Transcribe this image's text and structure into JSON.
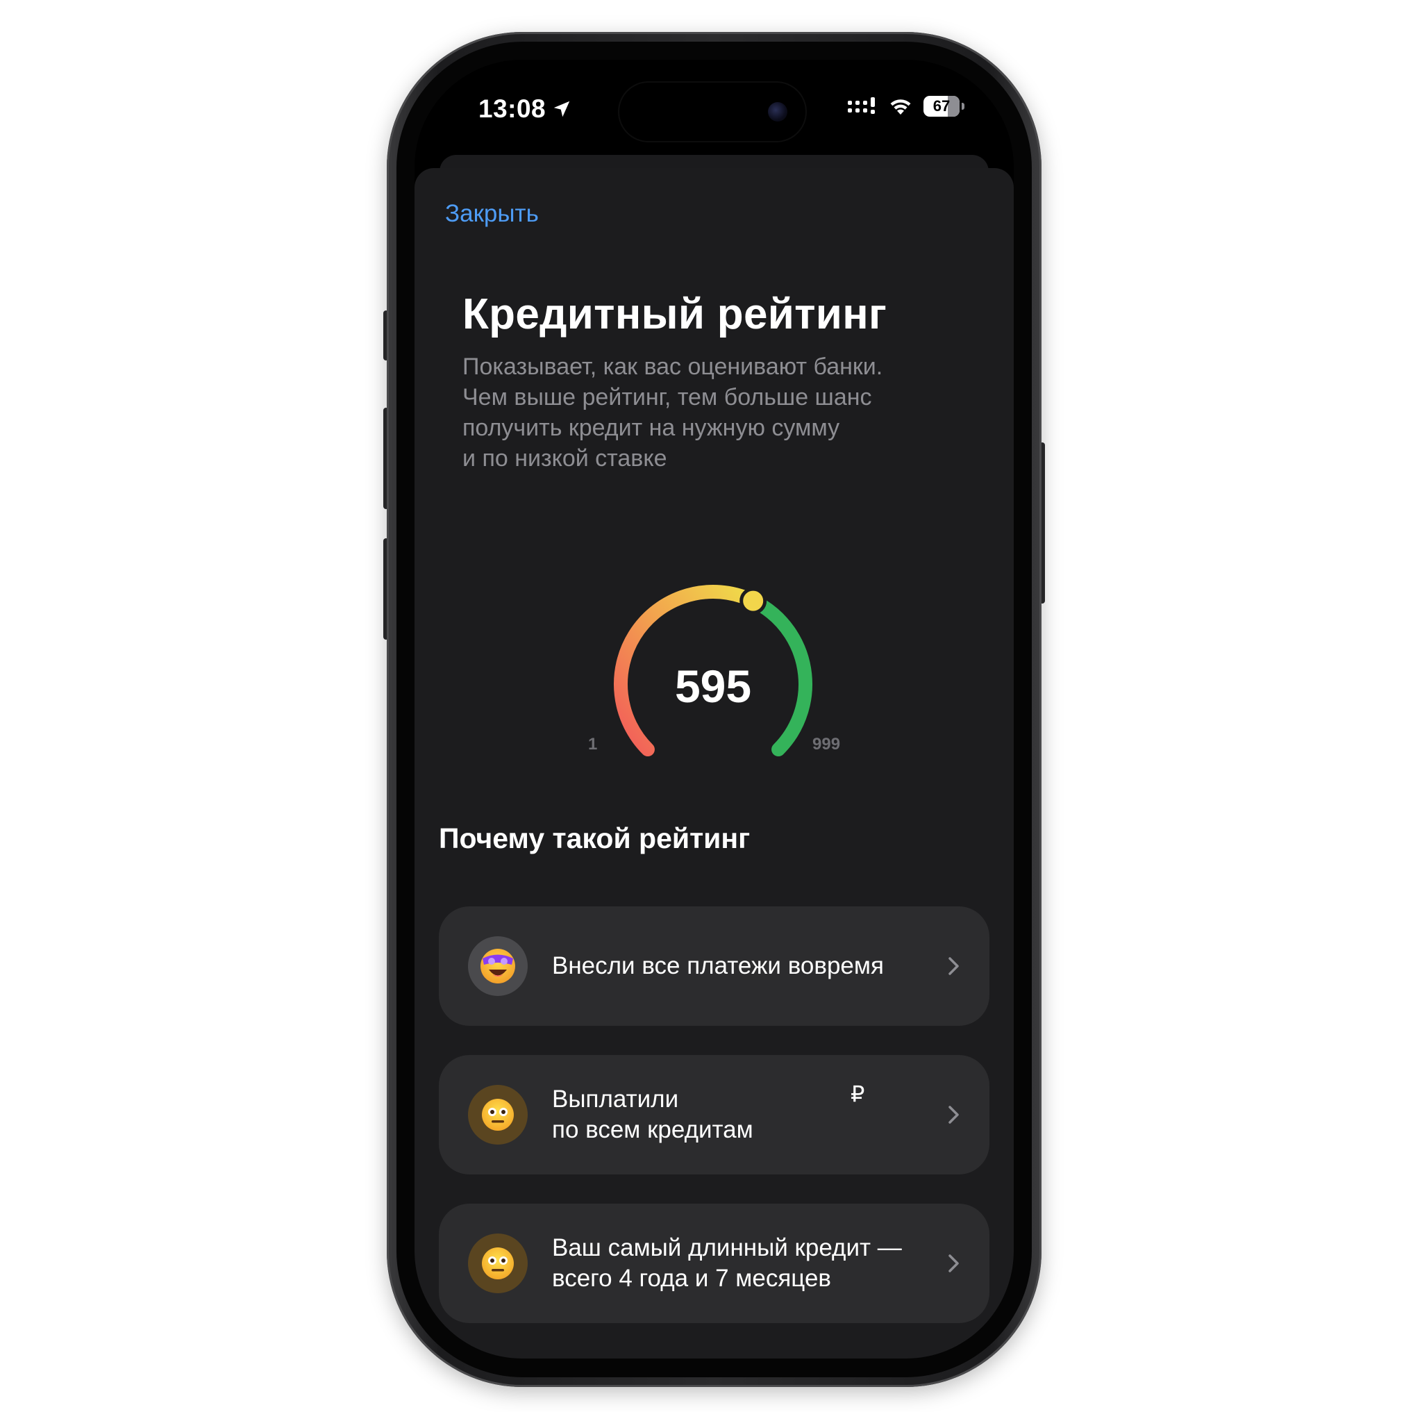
{
  "status_bar": {
    "time": "13:08",
    "battery": "67",
    "icons": [
      "location-arrow-icon",
      "cellular-signal-icon",
      "wifi-icon",
      "battery-icon"
    ]
  },
  "sheet": {
    "close_label": "Закрыть"
  },
  "header": {
    "title": "Кредитный рейтинг",
    "subtitle_lines": [
      "Показывает, как вас оценивают банки.",
      "Чем выше рейтинг, тем больше шанс",
      "получить кредит на нужную сумму",
      "и по низкой ставке"
    ]
  },
  "gauge": {
    "value": "595",
    "min_label": "1",
    "max_label": "999",
    "min": 1,
    "max": 999,
    "score": 595,
    "colors": {
      "low": "#f25a5a",
      "mid": "#f0d84a",
      "high": "#34b35a",
      "knob": "#f2d64b"
    }
  },
  "factors": {
    "title": "Почему такой рейтинг",
    "items": [
      {
        "lines": [
          "Внесли все платежи вовремя"
        ],
        "suffix": "",
        "icon": "star-struck-emoji-icon",
        "tone": "good"
      },
      {
        "lines": [
          "Выплатили",
          "по всем кредитам"
        ],
        "suffix": "₽",
        "icon": "neutral-face-emoji-icon",
        "tone": "meh"
      },
      {
        "lines": [
          "Ваш самый длинный кредит —",
          "всего 4 года и 7 месяцев"
        ],
        "suffix": "",
        "icon": "neutral-face-emoji-icon",
        "tone": "meh"
      }
    ]
  },
  "colors": {
    "accent_link": "#4e9cf5",
    "sheet_bg": "#1c1c1e",
    "card_bg": "#2c2c2e"
  }
}
